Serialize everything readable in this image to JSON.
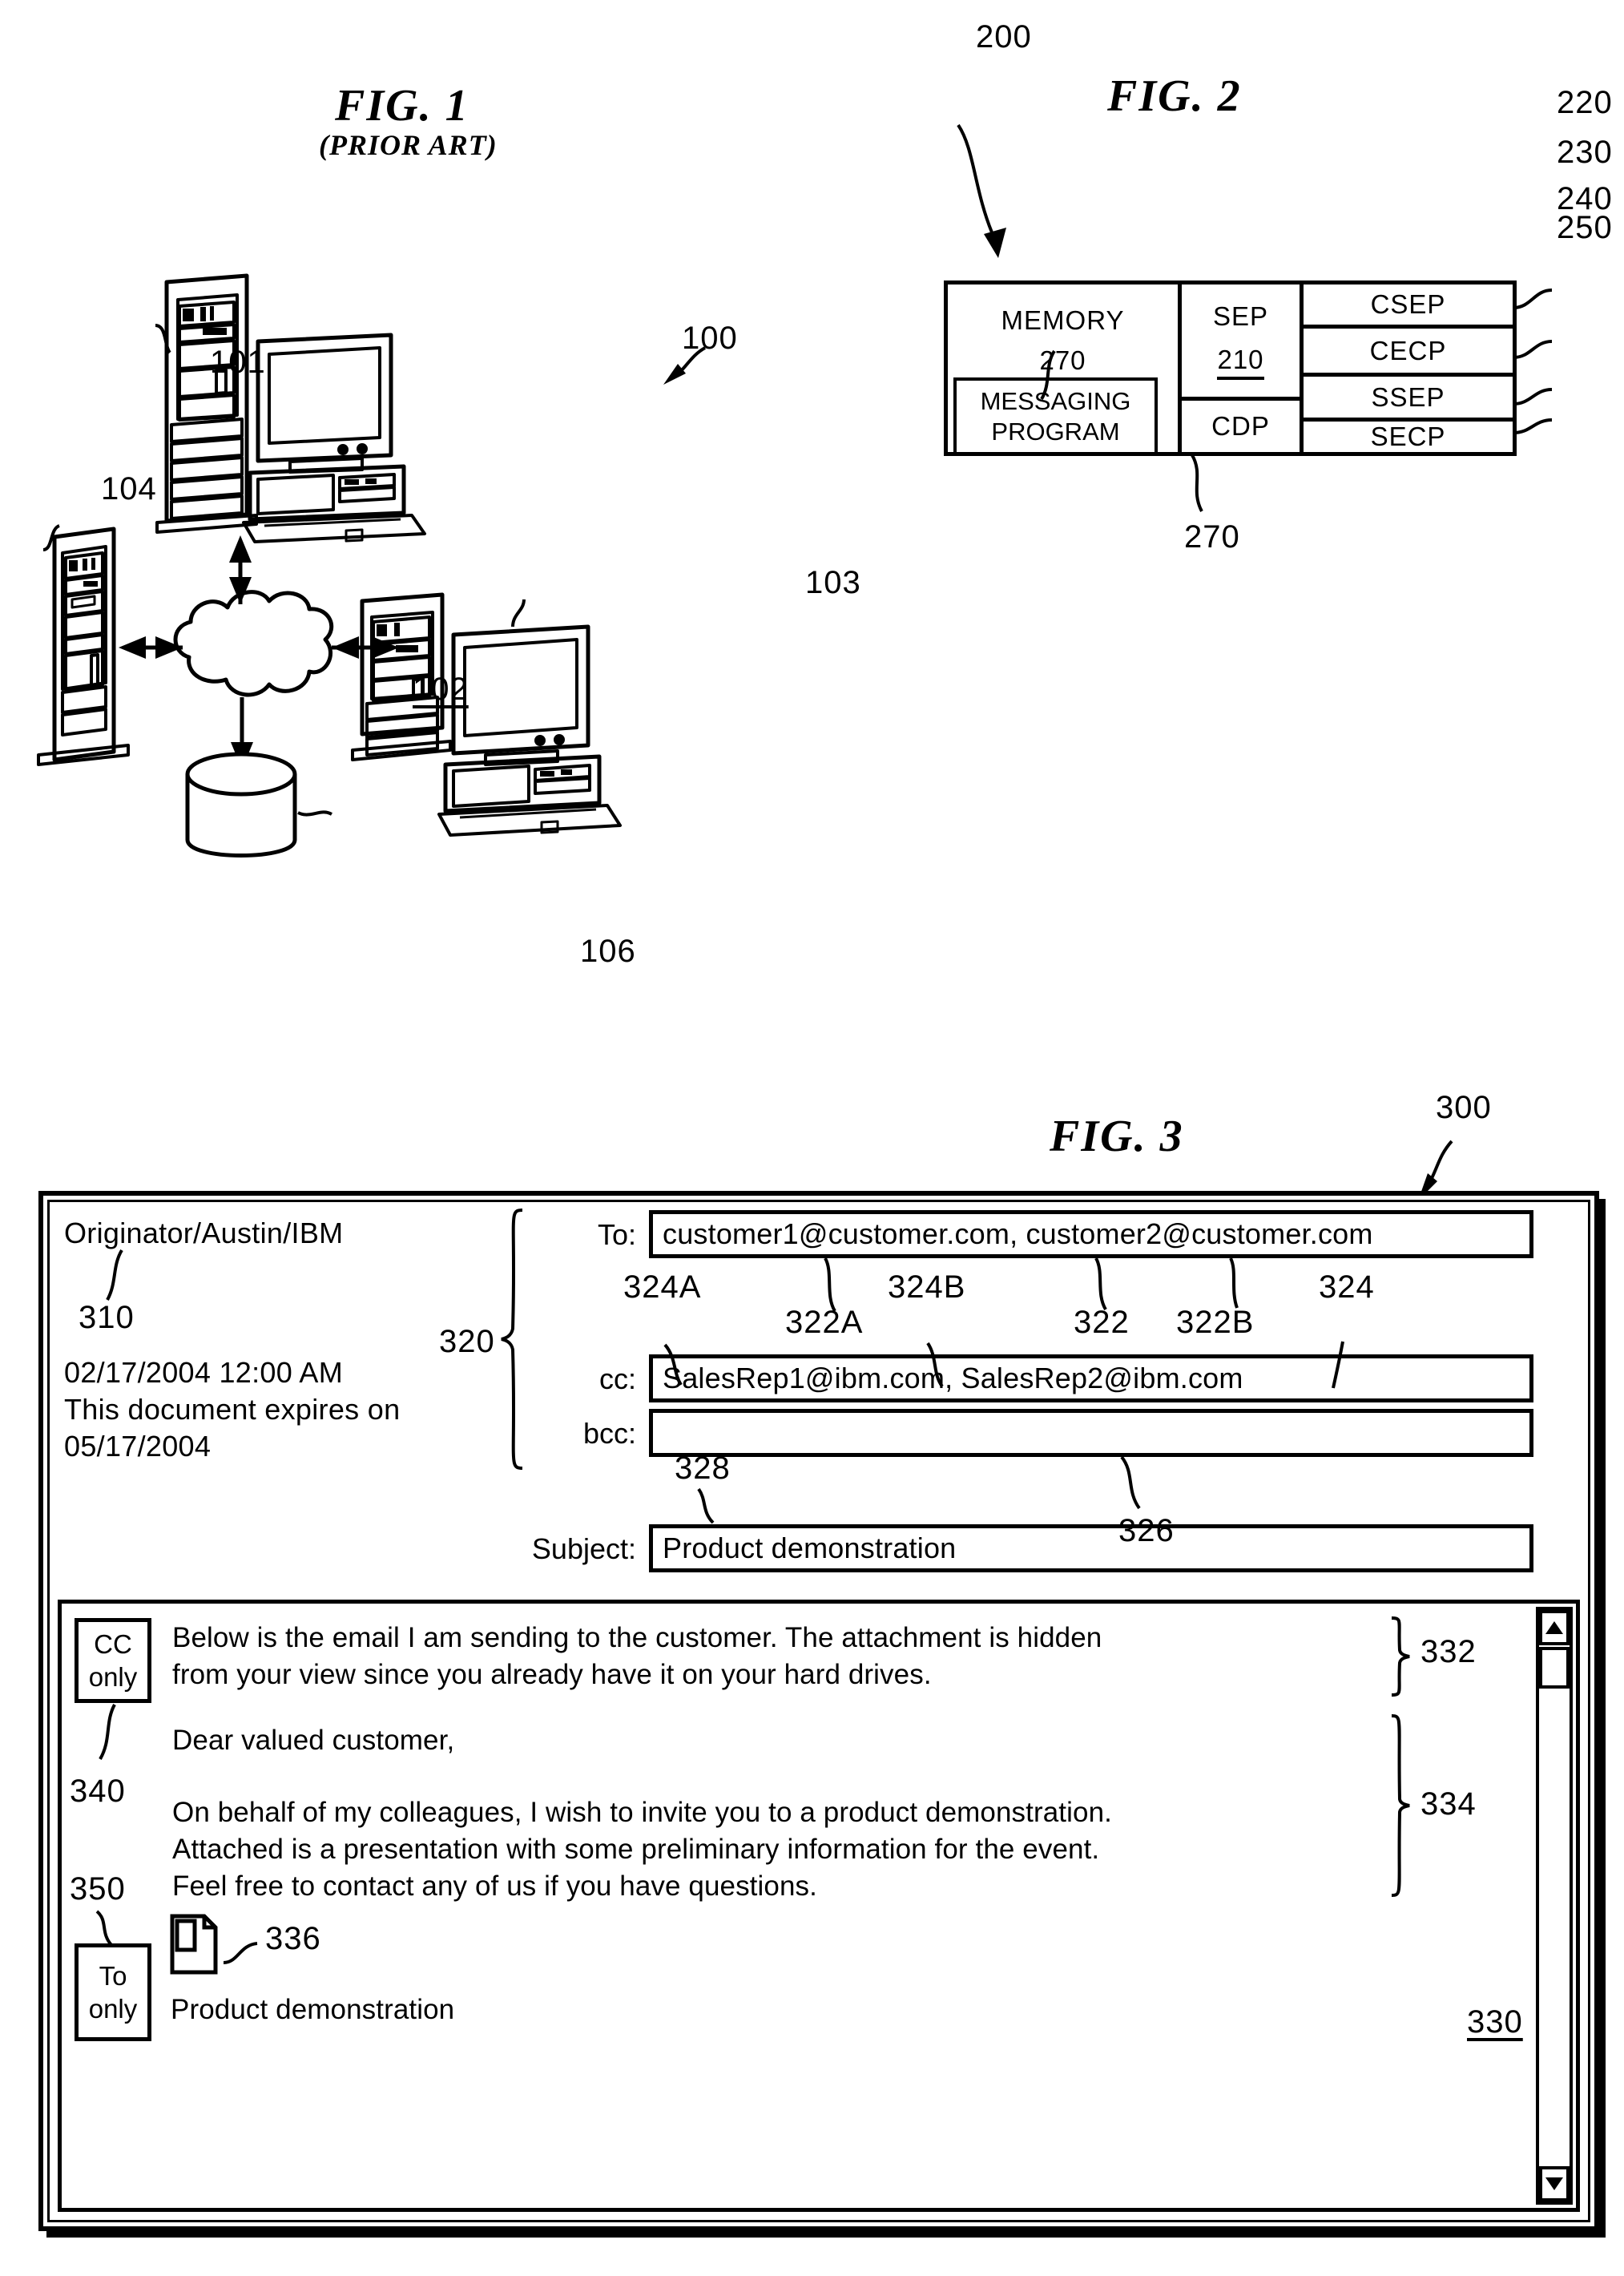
{
  "figures": {
    "fig1": {
      "title": "FIG. 1",
      "subtitle": "(PRIOR ART)",
      "refs": {
        "system": "100",
        "workstation_top": "101",
        "network": "102",
        "workstation_right": "103",
        "server": "104",
        "storage": "106"
      }
    },
    "fig2": {
      "title": "FIG. 2",
      "refs": {
        "computer_system": "200",
        "sep": "210",
        "csep": "220",
        "cecp": "230",
        "ssep": "240",
        "secp": "250",
        "memory": "270",
        "cdp": "270"
      },
      "blocks": {
        "memory": "MEMORY",
        "memory_num": "270",
        "messaging_program": "MESSAGING\nPROGRAM",
        "sep": "SEP",
        "sep_num": "210",
        "cdp": "CDP",
        "csep": "CSEP",
        "cecp": "CECP",
        "ssep": "SSEP",
        "secp": "SECP"
      }
    },
    "fig3": {
      "title": "FIG. 3",
      "refs": {
        "window": "300",
        "originator": "310",
        "address_group": "320",
        "address_entry": "322",
        "address_entry_a": "322A",
        "address_entry_b": "322B",
        "to_field": "324",
        "to_entry_a": "324A",
        "to_entry_b": "324B",
        "bcc_field": "326",
        "subject_field": "328",
        "body": "330",
        "cc_section": "332",
        "to_section": "334",
        "attachment": "336",
        "cc_tag": "340",
        "to_tag": "350"
      },
      "originator": {
        "name": "Originator/Austin/IBM",
        "timestamp": "02/17/2004 12:00 AM",
        "expiry_line1": "This document expires on",
        "expiry_line2": "05/17/2004"
      },
      "fields": [
        {
          "label": "To:",
          "value": "customer1@customer.com, customer2@customer.com"
        },
        {
          "label": "cc:",
          "value": "SalesRep1@ibm.com, SalesRep2@ibm.com"
        },
        {
          "label": "bcc:",
          "value": ""
        },
        {
          "label": "Subject:",
          "value": "Product demonstration"
        }
      ],
      "body": {
        "cc_tag": "CC\nonly",
        "to_tag": "To\nonly",
        "cc_para": [
          "Below is the email I am sending to the customer. The attachment is hidden",
          "from your view since you already have it on your hard drives."
        ],
        "to_para": [
          "Dear valued customer,",
          "On behalf of my colleagues, I wish to invite you to a product demonstration.",
          "Attached is a presentation with some preliminary information for the event.",
          "Feel free to contact any of us if you have questions."
        ],
        "attachment_name": "Product demonstration"
      },
      "scrollbar": {
        "up": "▲",
        "down": "▼"
      }
    }
  }
}
